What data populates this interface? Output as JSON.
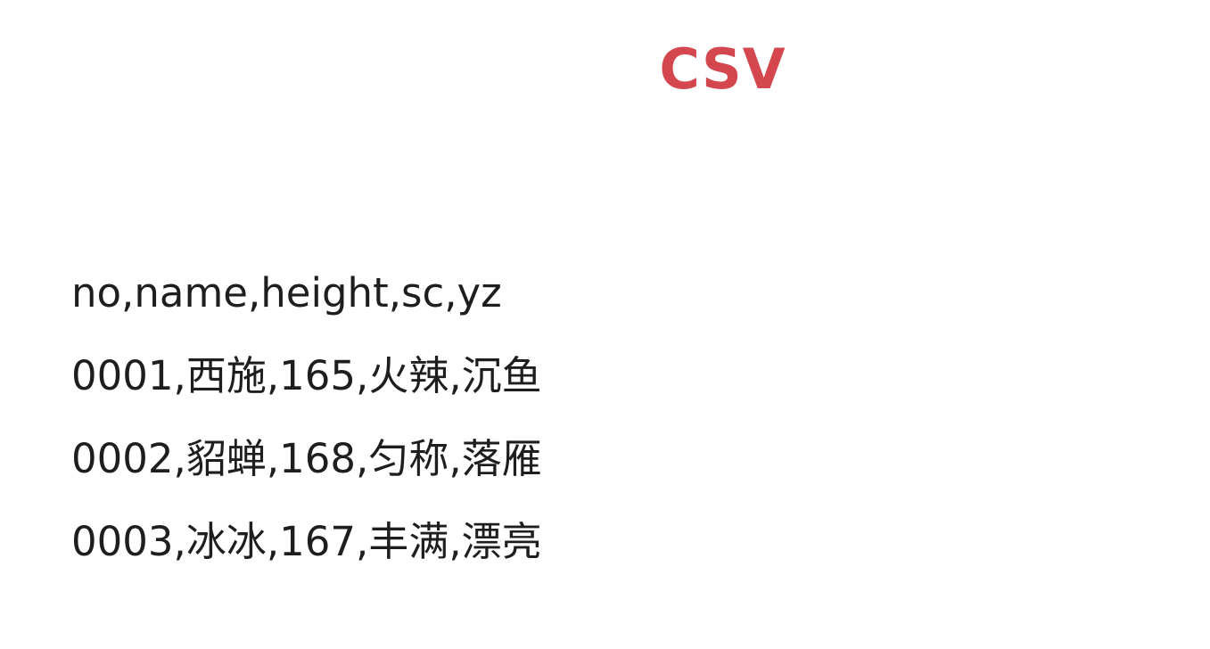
{
  "colors": {
    "title": "#d4474f",
    "text": "#1e1e1e",
    "background": "#ffffff"
  },
  "title": "CSV",
  "csv_lines": [
    "no,name,height,sc,yz",
    "0001,西施,165,火辣,沉鱼",
    "0002,貂蝉,168,匀称,落雁",
    "0003,冰冰,167,丰满,漂亮"
  ]
}
